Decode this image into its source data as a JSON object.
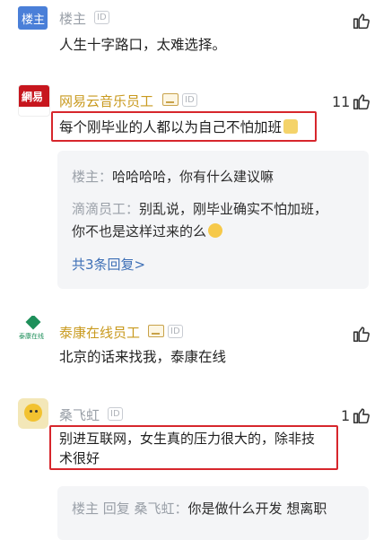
{
  "floor": {
    "badge": "楼主",
    "name": "楼主",
    "id_tag": "ID",
    "text": "人生十字路口，太难选择。"
  },
  "comments": [
    {
      "avatar_text": "網易",
      "name": "网易云音乐员工",
      "id_tag": "ID",
      "likes": "11",
      "text": "每个刚毕业的人都以为自己不怕加班",
      "replies": [
        {
          "name": "楼主：",
          "text": "哈哈哈哈，你有什么建议嘛"
        },
        {
          "name": "滴滴员工：",
          "text": "别乱说，刚毕业确实不怕加班，"
        },
        {
          "name": "",
          "text": "你不也是这样过来的么"
        }
      ],
      "more": "共3条回复>"
    },
    {
      "avatar_text": "泰康在线",
      "name": "泰康在线员工",
      "id_tag": "ID",
      "likes": "",
      "text": "北京的话来找我，泰康在线"
    },
    {
      "name": "桑飞虹",
      "id_tag": "ID",
      "likes": "1",
      "text_line1": "别进互联网，女生真的压力很大的，除非技",
      "text_line2": "术很好",
      "reply": {
        "name": "楼主 回复 桑飞虹：",
        "text": "你是做什么开发 想离职"
      }
    }
  ],
  "colors": {
    "highlight_border": "#d7262c",
    "link": "#3d6fb6",
    "name_grey": "#9aa0a8",
    "name_gold": "#c99a1f"
  }
}
